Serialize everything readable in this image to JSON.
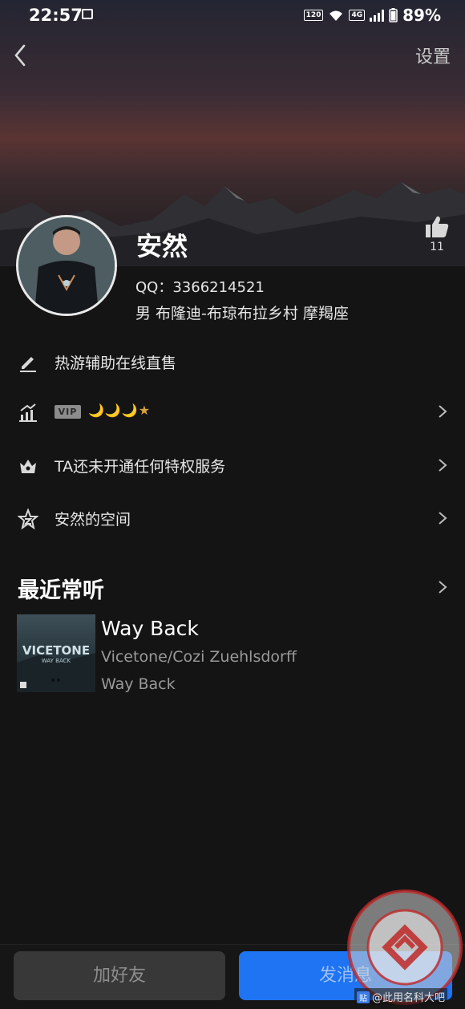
{
  "status_bar": {
    "time": "22:57",
    "badge_hd": "120",
    "network": "4G",
    "battery": "89%"
  },
  "header": {
    "settings_label": "设置"
  },
  "profile": {
    "nickname": "安然",
    "likes": "11",
    "qq_number": "QQ：3366214521",
    "info_line": "男  布隆迪-布琼布拉乡村  摩羯座"
  },
  "menu": {
    "signature": "热游辅助在线直售",
    "vip_badge": "VIP",
    "vip_level_icons": "🌙🌙🌙★",
    "privilege": "TA还未开通任何特权服务",
    "space": "安然的空间"
  },
  "recent": {
    "title": "最近常听",
    "song": {
      "title": "Way Back",
      "artist": "Vicetone/Cozi Zuehlsdorff",
      "album": "Way Back",
      "cover_text": "VICETONE",
      "cover_subtext": "WAY BACK"
    }
  },
  "actions": {
    "add_friend": "加好友",
    "send_message": "发消息"
  },
  "watermark": {
    "label": "贴",
    "text": "@此用名科大吧"
  },
  "colors": {
    "primary_blue": "#1e74f2",
    "background": "#141414",
    "vip_gold": "#d9a23a"
  }
}
